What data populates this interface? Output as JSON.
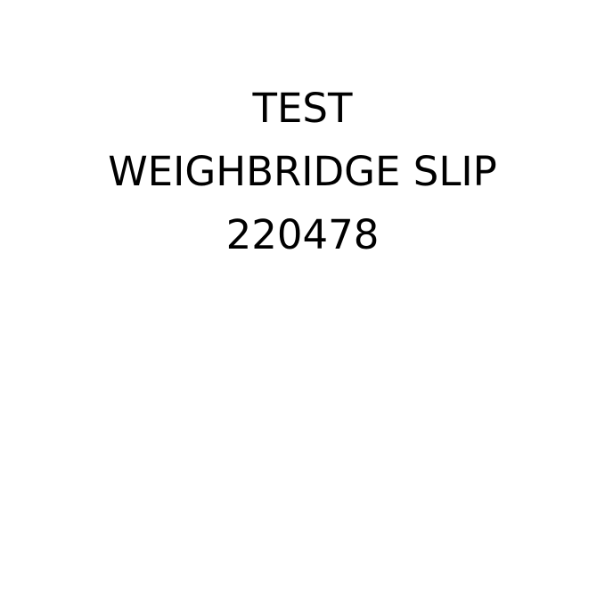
{
  "document": {
    "lines": [
      "TEST",
      "WEIGHBRIDGE SLIP",
      "220478"
    ],
    "colors": {
      "background": "#ffffff",
      "text": "#000000"
    }
  }
}
